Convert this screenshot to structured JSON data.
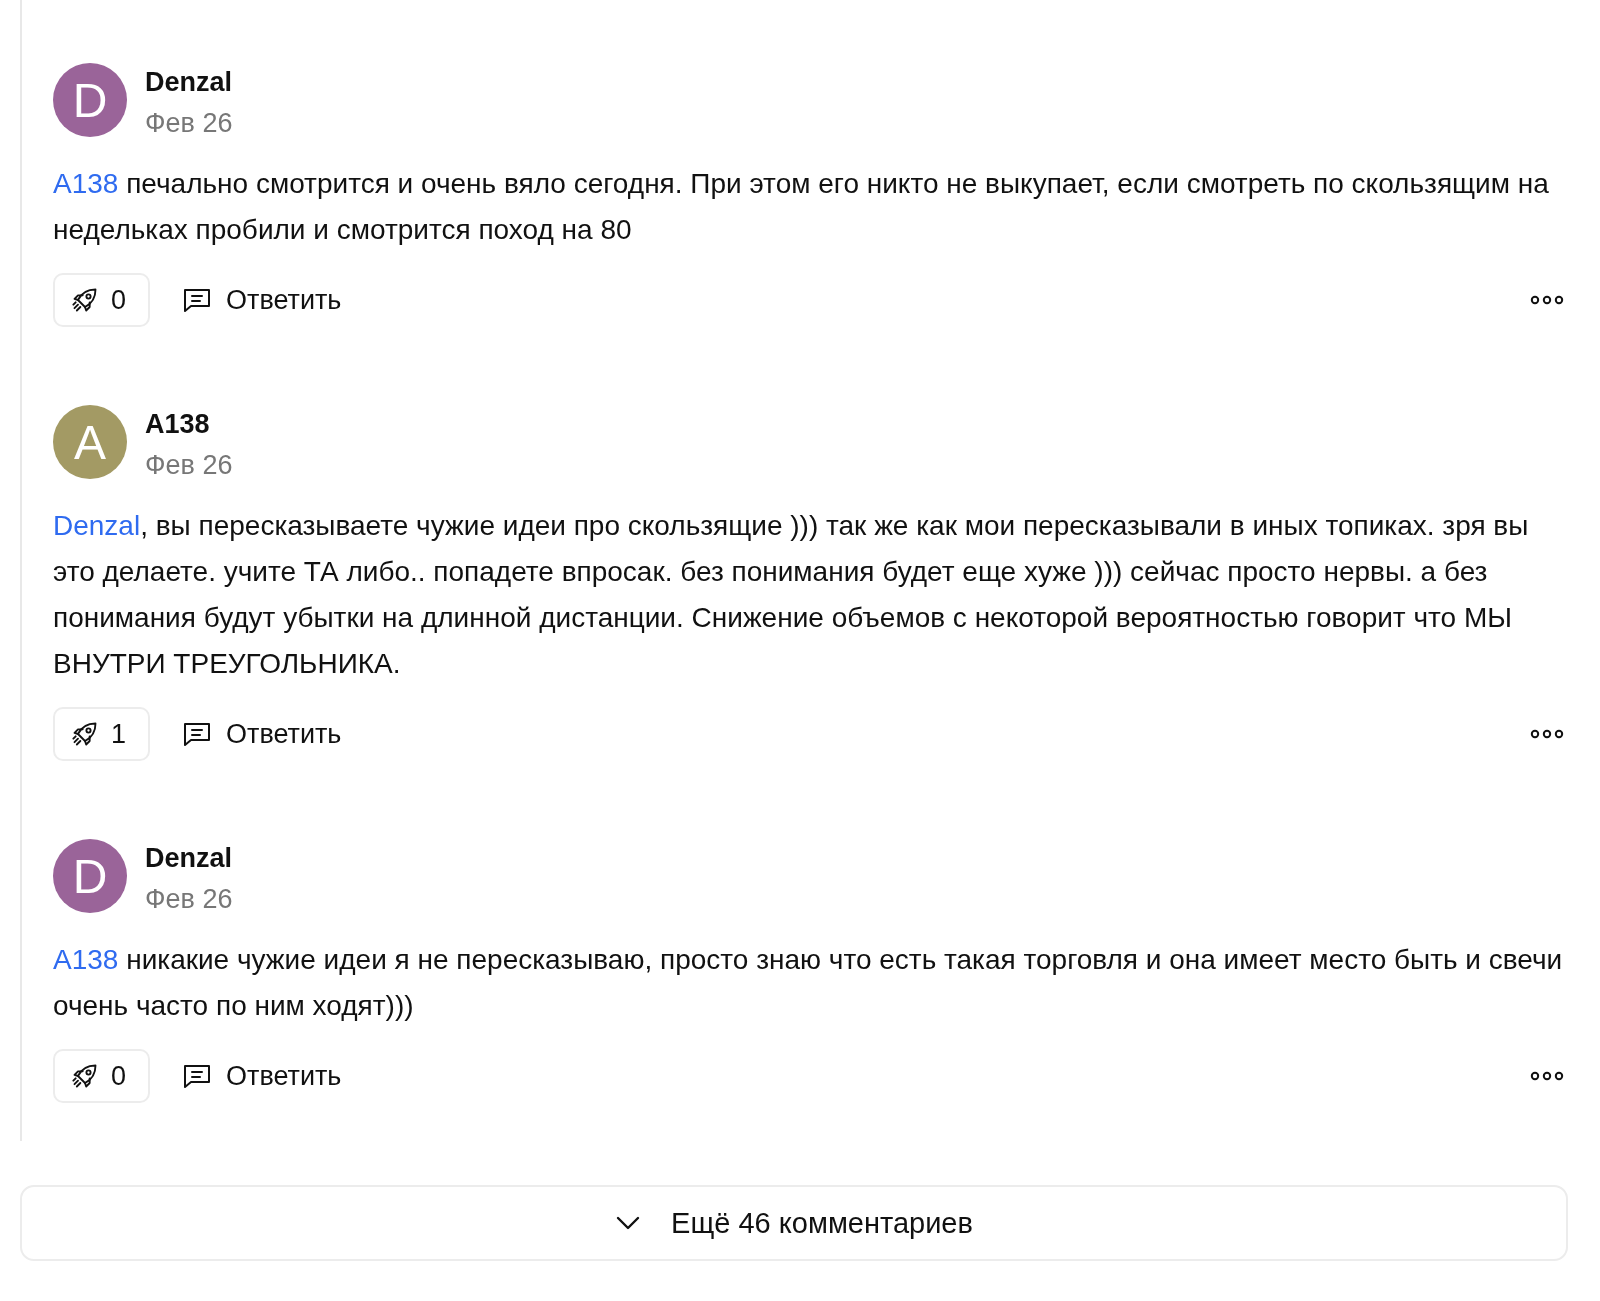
{
  "comments": [
    {
      "author": {
        "name": "Denzal",
        "initial": "D",
        "color": "#9a6499"
      },
      "date": "Фев 26",
      "mention": "A138",
      "text": " печально смотрится и очень вяло сегодня. При этом его никто не выкупает, если смотреть по скользящим на недельках пробили и смотрится поход на 80",
      "likes": "0",
      "reply": "Ответить"
    },
    {
      "author": {
        "name": "A138",
        "initial": "A",
        "color": "#a39a64"
      },
      "date": "Фев 26",
      "mention": "Denzal",
      "text": ", вы пересказываете чужие идеи про скользящие ))) так же как мои пересказывали в иных топиках. зря вы это делаете. учите ТА либо.. попадете впросак. без понимания будет еще хуже ))) сейчас просто нервы. а без понимания будут убытки на длинной дистанции. Снижение объемов с некоторой вероятностью говорит что МЫ ВНУТРИ ТРЕУГОЛЬНИКА.",
      "likes": "1",
      "reply": "Ответить"
    },
    {
      "author": {
        "name": "Denzal",
        "initial": "D",
        "color": "#9a6499"
      },
      "date": "Фев 26",
      "mention": "A138",
      "text": " никакие чужие идеи я не пересказываю, просто знаю что есть такая торговля и она имеет место быть и свечи очень часто по ним ходят)))",
      "likes": "0",
      "reply": "Ответить"
    }
  ],
  "show_more": {
    "label": "Ещё 46 комментариев"
  }
}
